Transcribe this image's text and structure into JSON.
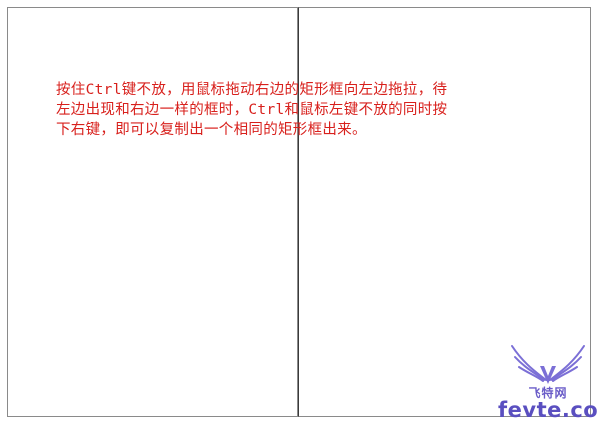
{
  "instruction_text": "按住Ctrl键不放，用鼠标拖动右边的矩形框向左边拖拉，待\n左边出现和右边一样的框时，Ctrl和鼠标左键不放的同时按\n下右键，即可以复制出一个相同的矩形框出来。",
  "watermark": {
    "chinese_text": "飞特网",
    "domain_text": "fevte.com",
    "icon": "wings-logo-icon",
    "color": "#6a5cc8"
  },
  "colors": {
    "text": "#d8201c",
    "frame_border": "#8a8a8a",
    "divider": "#3a3a3a"
  }
}
